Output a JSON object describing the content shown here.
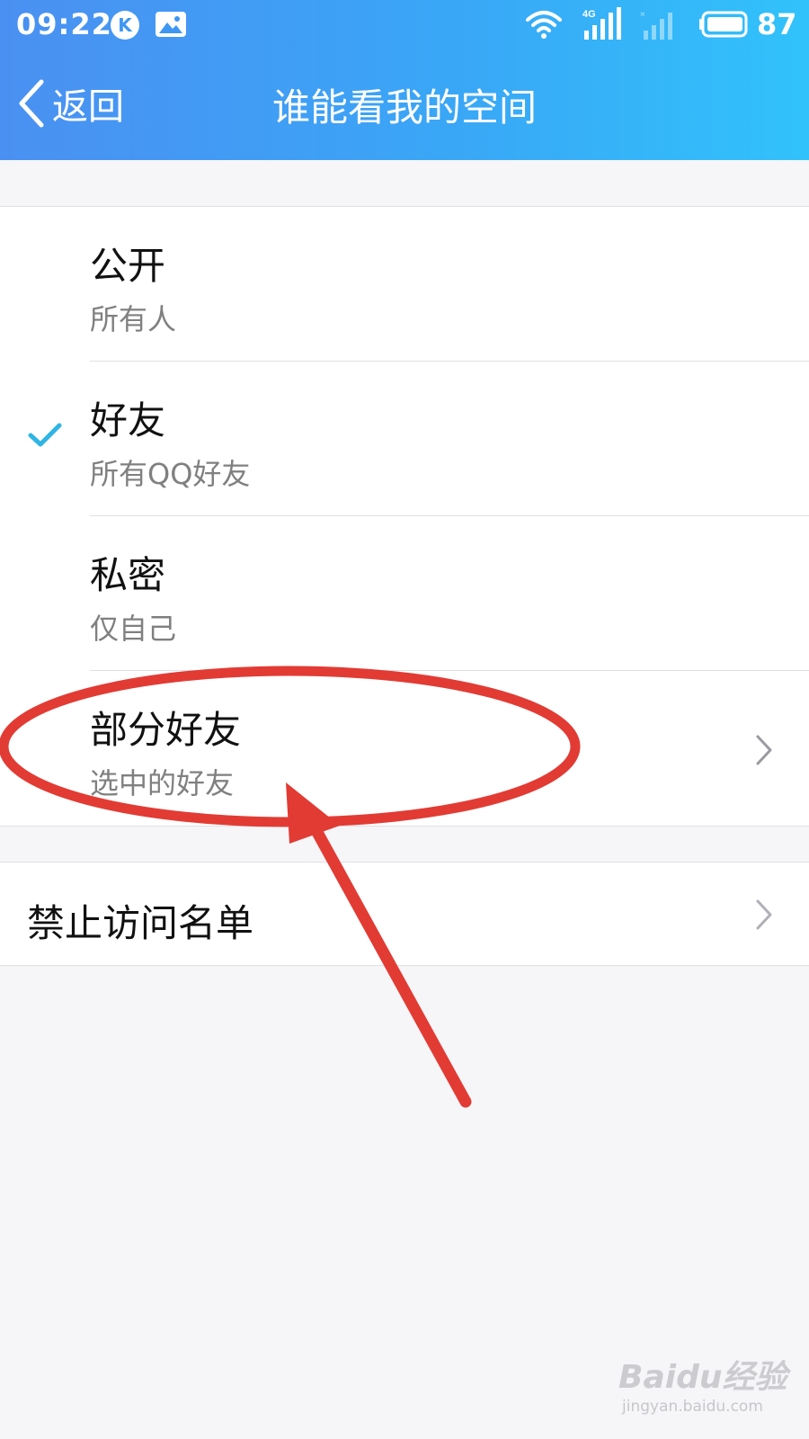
{
  "status_bar": {
    "time": "09:22",
    "k_badge": "K",
    "network_label": "4G",
    "battery_level": "87"
  },
  "nav": {
    "back_label": "返回",
    "title": "谁能看我的空间"
  },
  "options": [
    {
      "title": "公开",
      "subtitle": "所有人",
      "selected": false,
      "has_chevron": false
    },
    {
      "title": "好友",
      "subtitle": "所有QQ好友",
      "selected": true,
      "has_chevron": false
    },
    {
      "title": "私密",
      "subtitle": "仅自己",
      "selected": false,
      "has_chevron": false
    },
    {
      "title": "部分好友",
      "subtitle": "选中的好友",
      "selected": false,
      "has_chevron": true
    }
  ],
  "blocklist": {
    "label": "禁止访问名单"
  },
  "watermark": {
    "brand": "Baidu经验",
    "url": "jingyan.baidu.com"
  },
  "colors": {
    "header_gradient_start": "#4a90f2",
    "header_gradient_end": "#31c2fb",
    "check_accent": "#2fb5e4",
    "annotation_red": "#e23b34"
  },
  "icons": [
    "k-icon",
    "gallery-icon",
    "wifi-icon",
    "signal-4g-icon",
    "signal-empty-icon",
    "battery-icon",
    "back-chevron-icon",
    "check-icon",
    "chevron-right-icon"
  ]
}
